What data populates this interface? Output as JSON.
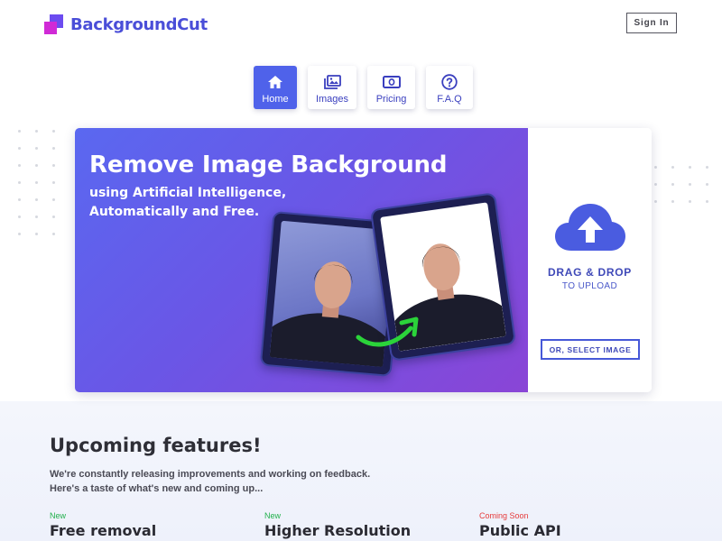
{
  "header": {
    "brand": "BackgroundCut",
    "signin_label": "Sign In"
  },
  "nav": {
    "tabs": [
      {
        "label": "Home",
        "icon": "home-icon",
        "active": true
      },
      {
        "label": "Images",
        "icon": "images-icon",
        "active": false
      },
      {
        "label": "Pricing",
        "icon": "money-icon",
        "active": false
      },
      {
        "label": "F.A.Q",
        "icon": "question-icon",
        "active": false
      }
    ]
  },
  "hero": {
    "title": "Remove Image Background",
    "subtitle_line1": "using Artificial Intelligence,",
    "subtitle_line2": "Automatically and Free."
  },
  "upload": {
    "icon": "cloud-upload-icon",
    "drag_label": "DRAG & DROP",
    "drag_sub": "TO UPLOAD",
    "select_label": "OR, SELECT IMAGE"
  },
  "features": {
    "title": "Upcoming features!",
    "desc_line1": "We're constantly releasing improvements and working on feedback.",
    "desc_line2": "Here's a taste of what's new and coming up...",
    "items": [
      {
        "tag": "New",
        "name": "Free removal"
      },
      {
        "tag": "New",
        "name": "Higher Resolution"
      },
      {
        "tag": "Coming Soon",
        "name": "Public API"
      }
    ]
  },
  "colors": {
    "brand": "#4a4ed8",
    "accent": "#4f62ea",
    "new_tag": "#22b14c",
    "soon_tag": "#e53b3b"
  }
}
